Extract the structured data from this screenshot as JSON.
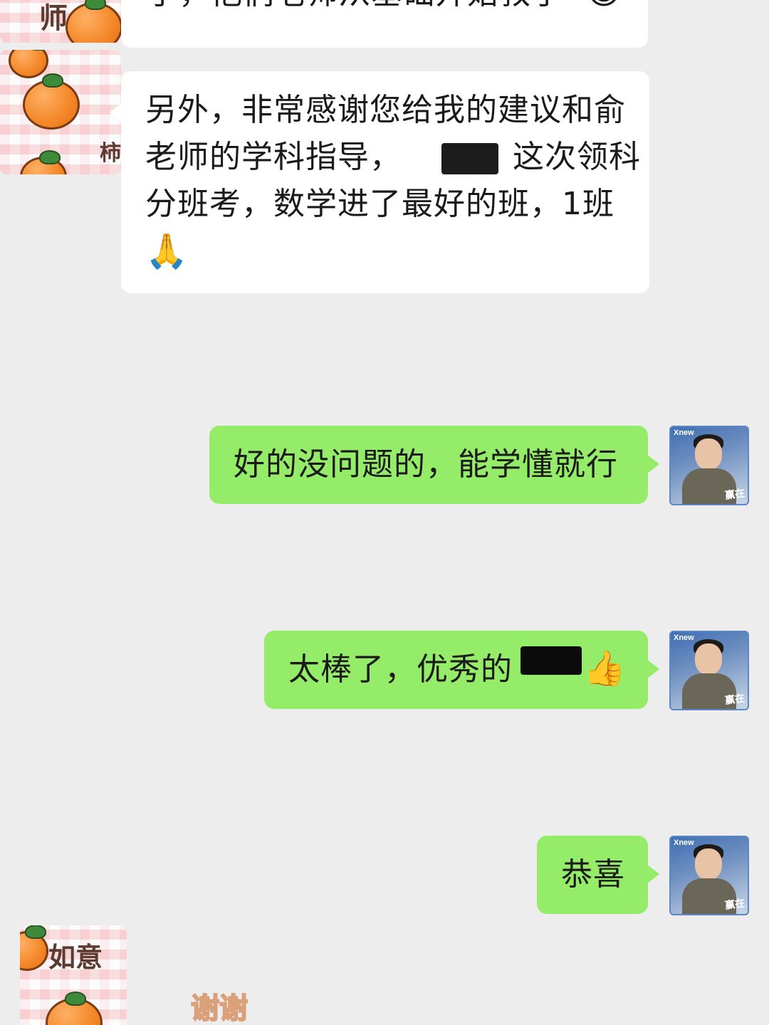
{
  "messages": [
    {
      "id": "m1",
      "side": "left",
      "text_main": "了，他们老师从基础开始教了",
      "emoji": "😂"
    },
    {
      "id": "m2",
      "side": "left",
      "line1": "另外，非常感谢您给我的建议和俞",
      "line2_a": "老师的学科指导，",
      "line2_b": "这次领科",
      "line3": "分班考，数学进了最好的班，1班",
      "emoji": "🙏"
    },
    {
      "id": "m3",
      "side": "right",
      "text": "好的没问题的，能学懂就行"
    },
    {
      "id": "m4",
      "side": "right",
      "text": "太棒了，优秀的",
      "emoji": "👍"
    },
    {
      "id": "m5",
      "side": "right",
      "text": "恭喜"
    }
  ],
  "left_avatar": {
    "icon": "persimmon-icon",
    "caption_top": "师",
    "caption_mid": "柿",
    "caption_bottom": "如意"
  },
  "right_avatar": {
    "brand": "Xnew",
    "slogan": "赢在"
  },
  "sticker": {
    "text": "谢谢"
  },
  "colors": {
    "background": "#ededed",
    "bubble_left": "#ffffff",
    "bubble_right": "#95ec69",
    "text": "#1a1a1a"
  }
}
